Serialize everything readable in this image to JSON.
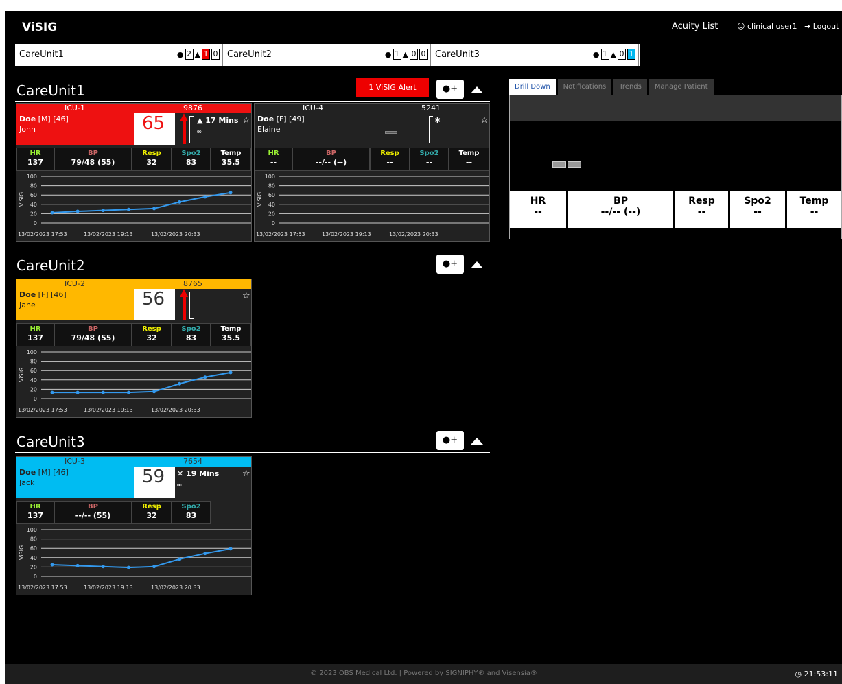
{
  "nav": {
    "brand": "ViSIG",
    "acuity_list": "Acuity List",
    "user": "clinical user1",
    "logout": "Logout"
  },
  "units_bar": [
    {
      "name": "CareUnit1",
      "patients": "2",
      "alerts": "1",
      "other": "0",
      "highlight": "red"
    },
    {
      "name": "CareUnit2",
      "patients": "1",
      "alerts": "0",
      "other": "0",
      "highlight": "none"
    },
    {
      "name": "CareUnit3",
      "patients": "1",
      "alerts": "0",
      "other": "1",
      "highlight": "blue"
    }
  ],
  "sections": {
    "unit1": {
      "title": "CareUnit1",
      "alert_label": "1 ViSIG Alert"
    },
    "unit2": {
      "title": "CareUnit2"
    },
    "unit3": {
      "title": "CareUnit3"
    }
  },
  "cards": {
    "icu1": {
      "location": "ICU-1",
      "bed": "9876",
      "surname": "Doe",
      "demo": " [M] [46]",
      "first": "John",
      "score": "65",
      "notif": "17 Mins",
      "header_color": "#ee1111",
      "score_color": "#ee1111",
      "vitals": {
        "hr": "137",
        "bp": "79/48 (55)",
        "resp": "32",
        "spo2": "83",
        "temp": "35.5"
      },
      "chart_data": {
        "type": "line",
        "y_label": "ViSIG",
        "yticks": [
          0,
          20,
          40,
          60,
          80,
          100
        ],
        "ylim": [
          0,
          100
        ],
        "x_labels": [
          "13/02/2023 17:53",
          "13/02/2023 19:13",
          "13/02/2023 20:33"
        ],
        "values": [
          22,
          25,
          27,
          29,
          31,
          45,
          56,
          65
        ]
      }
    },
    "icu4": {
      "location": "ICU-4",
      "bed": "5241",
      "surname": "Doe",
      "demo": " [F] [49]",
      "first": "Elaine",
      "score": "",
      "notif": "",
      "vitals": {
        "hr": "--",
        "bp": "--/-- (--)",
        "resp": "--",
        "spo2": "--",
        "temp": "--"
      },
      "chart_data": {
        "type": "line",
        "y_label": "ViSIG",
        "yticks": [
          0,
          20,
          40,
          60,
          80,
          100
        ],
        "ylim": [
          0,
          100
        ],
        "x_labels": [
          "13/02/2023 17:53",
          "13/02/2023 19:13",
          "13/02/2023 20:33"
        ],
        "values": []
      }
    },
    "icu2": {
      "location": "ICU-2",
      "bed": "8765",
      "surname": "Doe",
      "demo": " [F] [46]",
      "first": "Jane",
      "score": "56",
      "notif": "",
      "header_color": "#ffb800",
      "vitals": {
        "hr": "137",
        "bp": "79/48 (55)",
        "resp": "32",
        "spo2": "83",
        "temp": "35.5"
      },
      "chart_data": {
        "type": "line",
        "y_label": "ViSIG",
        "yticks": [
          0,
          20,
          40,
          60,
          80,
          100
        ],
        "ylim": [
          0,
          100
        ],
        "x_labels": [
          "13/02/2023 17:53",
          "13/02/2023 19:13",
          "13/02/2023 20:33"
        ],
        "values": [
          13,
          13,
          13,
          13,
          15,
          32,
          46,
          56
        ]
      }
    },
    "icu3": {
      "location": "ICU-3",
      "bed": "7654",
      "surname": "Doe",
      "demo": " [M] [46]",
      "first": "Jack",
      "score": "59",
      "notif": "19 Mins",
      "header_color": "#00bcf2",
      "vitals": {
        "hr": "137",
        "bp": "--/-- (55)",
        "resp": "32",
        "spo2": "83"
      },
      "chart_data": {
        "type": "line",
        "y_label": "ViSIG",
        "yticks": [
          0,
          20,
          40,
          60,
          80,
          100
        ],
        "ylim": [
          0,
          100
        ],
        "x_labels": [
          "13/02/2023 17:53",
          "13/02/2023 19:13",
          "13/02/2023 20:33"
        ],
        "values": [
          25,
          23,
          21,
          19,
          21,
          37,
          49,
          59
        ]
      }
    }
  },
  "vital_labels": {
    "hr": "HR",
    "bp": "BP",
    "resp": "Resp",
    "spo2": "Spo2",
    "temp": "Temp"
  },
  "right_panel": {
    "tabs": [
      "Drill Down",
      "Notifications",
      "Trends",
      "Manage Patient"
    ],
    "vitals": {
      "hr": "--",
      "bp": "--/-- (--)",
      "resp": "--",
      "spo2": "--",
      "temp": "--"
    }
  },
  "footer": {
    "copyright": "© 2023 OBS Medical Ltd. | Powered by SIGNIPHY® and Visensia®",
    "clock": "21:53:11"
  }
}
